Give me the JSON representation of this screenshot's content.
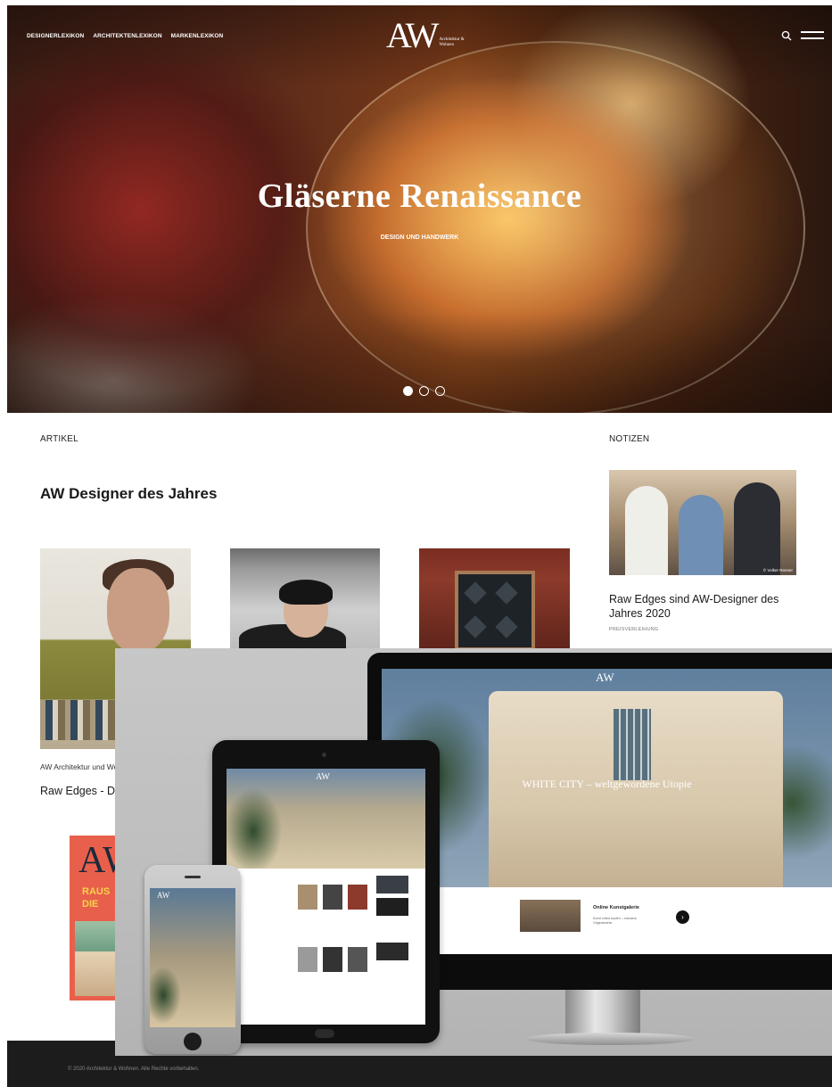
{
  "nav": {
    "items": [
      "DESIGNERLEXIKON",
      "ARCHITEKTENLEXIKON",
      "MARKENLEXIKON"
    ]
  },
  "logo": {
    "mark": "AW",
    "subtitle": "Architektur & Wohnen"
  },
  "hero": {
    "title": "Gläserne Renaissance",
    "subtitle": "DESIGN UND HANDWERK",
    "slides": 3,
    "active_slide": 1
  },
  "articles": {
    "label": "ARTIKEL",
    "title": "AW Designer des Jahres",
    "card_text": "AW Architektur und Wohnen Designer des Jahres",
    "card_headline": "Raw Edges - D"
  },
  "notes": {
    "label": "NOTIZEN",
    "headline": "Raw Edges sind AW-Designer des Jahres 2020",
    "tag": "PREISVERLEIHUNG",
    "photo_credit": "© Volker Renner"
  },
  "magazine": {
    "mark": "AW",
    "cover_text": "RAUS DIE"
  },
  "devices": {
    "monitor_title": "WHITE CITY – weltgewordene Utopie",
    "monitor_card_title": "Online Kunstgalerie",
    "monitor_card_text": "Kunst online kaufen – exklusive Originalwerke",
    "next_symbol": "›",
    "logo_small": "AW"
  },
  "footer": {
    "copyright": "© 2020 Architektur & Wohnen. Alle Rechte vorbehalten."
  },
  "colors": {
    "accent_magazine": "#e8604c",
    "footer_bg": "#1c1c1c"
  }
}
